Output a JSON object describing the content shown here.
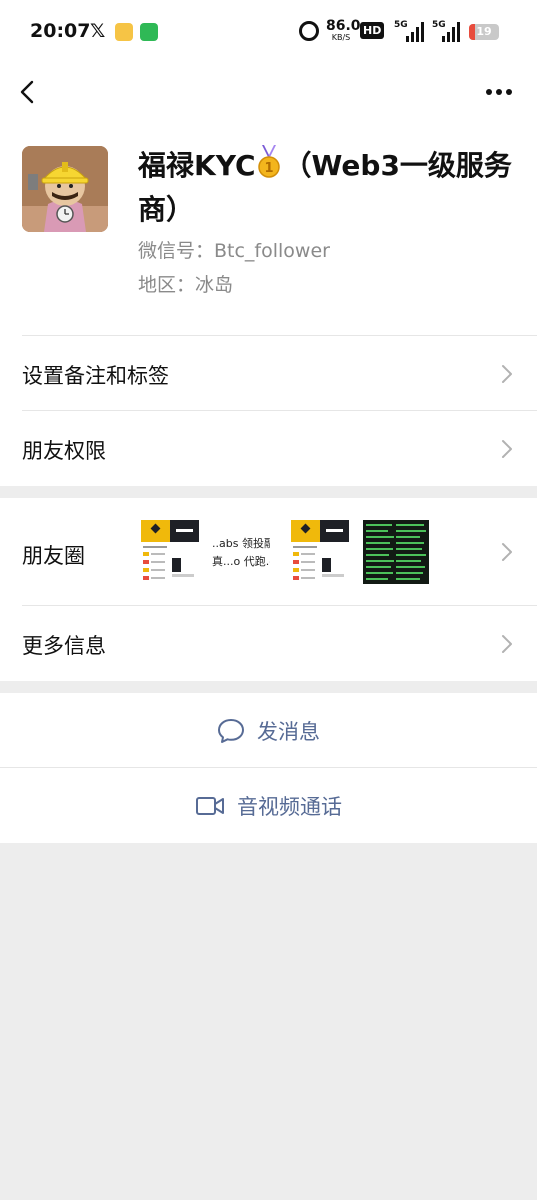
{
  "status_bar": {
    "time": "20:07",
    "x_logo": "𝕏",
    "speed_value": "86.0",
    "speed_unit": "KB/S",
    "hd": "HD",
    "hd_sub": "1 2",
    "net_1": "5G",
    "net_2": "5G",
    "battery": "19",
    "battery_level": 0.19,
    "battery_color": "#e84c3d"
  },
  "nav": {
    "back_icon": "chevron-left-icon",
    "more_icon": "more-dots-icon"
  },
  "profile": {
    "name_part1": "福禄KYC",
    "name_part2": "（Web3一级服务商）",
    "wechat_id": "微信号：Btc_follower",
    "region": "地区：冰岛"
  },
  "menu": {
    "remark_label": "设置备注和标签",
    "permissions_label": "朋友权限",
    "moments_label": "朋友圈",
    "moments_thumb2_line1": "..abs 领投融资",
    "moments_thumb2_line2": "真...o 代跑.dc",
    "more_info_label": "更多信息"
  },
  "actions": {
    "message_label": "发消息",
    "call_label": "音视频通话"
  },
  "colors": {
    "link_blue": "#576b95",
    "page_bg": "#ededed",
    "binance_yellow": "#f0b90b"
  }
}
